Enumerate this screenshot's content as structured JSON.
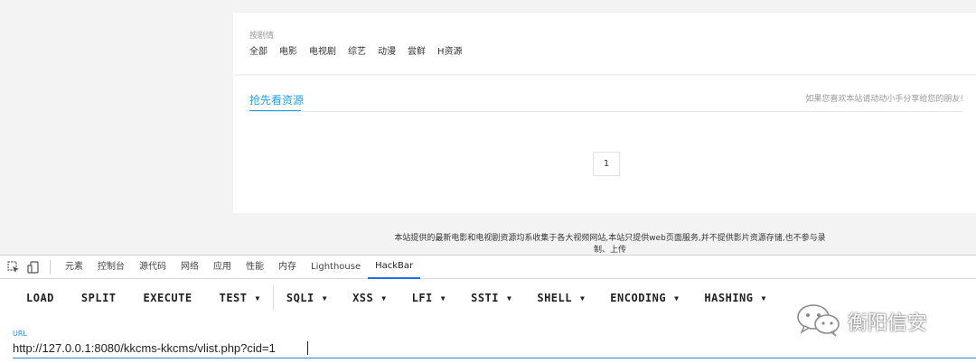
{
  "filter": {
    "title": "按剧情",
    "items": [
      "全部",
      "电影",
      "电视剧",
      "综艺",
      "动漫",
      "尝鲜",
      "H资源"
    ]
  },
  "main": {
    "tab_label": "抢先看资源",
    "share_text": "如果您喜欢本站请动动小手分享给您的朋友!",
    "page_number": "1"
  },
  "footer": {
    "line1": "本站提供的最新电影和电视剧资源均系收集于各大视频网站,本站只提供web页面服务,并不提供影片资源存储,也不参与录",
    "line2": "制、上传"
  },
  "devtools": {
    "tabs": [
      "元素",
      "控制台",
      "源代码",
      "网络",
      "应用",
      "性能",
      "内存",
      "Lighthouse",
      "HackBar"
    ],
    "active_tab": "HackBar"
  },
  "hackbar": {
    "buttons": [
      {
        "label": "LOAD",
        "dropdown": false
      },
      {
        "label": "SPLIT",
        "dropdown": false
      },
      {
        "label": "EXECUTE",
        "dropdown": false
      },
      {
        "label": "TEST",
        "dropdown": true
      },
      {
        "label": "SQLI",
        "dropdown": true
      },
      {
        "label": "XSS",
        "dropdown": true
      },
      {
        "label": "LFI",
        "dropdown": true
      },
      {
        "label": "SSTI",
        "dropdown": true
      },
      {
        "label": "SHELL",
        "dropdown": true
      },
      {
        "label": "ENCODING",
        "dropdown": true
      },
      {
        "label": "HASHING",
        "dropdown": true
      }
    ],
    "url_label": "URL",
    "url_value": "http://127.0.0.1:8080/kkcms-kkcms/vlist.php?cid=1"
  },
  "watermark": {
    "text": "衡阳信安",
    "icon": "wechat-icon"
  },
  "colors": {
    "accent": "#1e9fff",
    "devtools_accent": "#1a73e8",
    "url_accent": "#1e88e5"
  }
}
